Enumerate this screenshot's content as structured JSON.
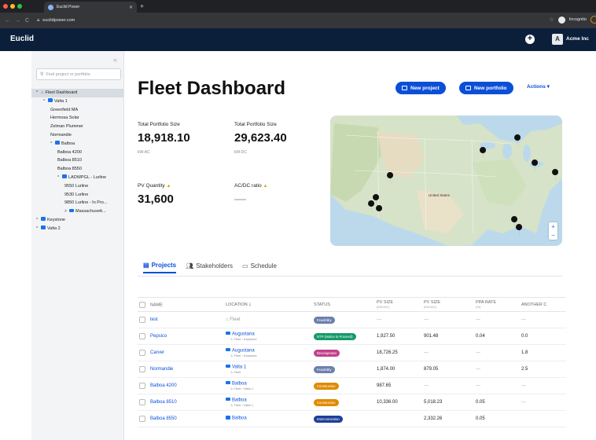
{
  "browser": {
    "tab_title": "Euclid Power",
    "url": "euclidpower.com",
    "incognito_label": "Incognito"
  },
  "header": {
    "brand": "Euclid",
    "avatar_letter": "A",
    "org_name": "Acme Inc"
  },
  "sidebar": {
    "search_placeholder": "Find project or portfolio",
    "tree": [
      {
        "label": "Fleet Dashboard",
        "indent": 0,
        "caret": "^",
        "icon": "home",
        "active": true
      },
      {
        "label": "Valta 1",
        "indent": 1,
        "caret": "^",
        "icon": "folder"
      },
      {
        "label": "Greenfield MA",
        "indent": 2
      },
      {
        "label": "Hermosa Solar",
        "indent": 2
      },
      {
        "label": "Zelman Plummer",
        "indent": 2
      },
      {
        "label": "Normandie",
        "indent": 2
      },
      {
        "label": "Balboa",
        "indent": 2,
        "caret": "^",
        "icon": "folder"
      },
      {
        "label": "Balboa 4200",
        "indent": 3
      },
      {
        "label": "Balboa 8510",
        "indent": 3
      },
      {
        "label": "Balboa 8550",
        "indent": 3
      },
      {
        "label": "LADWPGL - Lurline",
        "indent": 3,
        "caret": "^",
        "icon": "folder"
      },
      {
        "label": "9550 Lurline",
        "indent": 4
      },
      {
        "label": "9530 Lurline",
        "indent": 4
      },
      {
        "label": "9850 Lurline - In Pro...",
        "indent": 4
      },
      {
        "label": "Massachusett...",
        "indent": 4,
        "caret": ">",
        "icon": "folder"
      },
      {
        "label": "Keystone",
        "indent": 0,
        "caret": "^",
        "icon": "folder"
      },
      {
        "label": "Valta 2",
        "indent": 0,
        "caret": "^",
        "icon": "folder"
      }
    ]
  },
  "main": {
    "title": "Fleet Dashboard",
    "new_project_label": "New project",
    "new_portfolio_label": "New portfolio",
    "actions_label": "Actions",
    "stats": {
      "total_ac_label": "Total Portfolio Size",
      "total_ac_value": "18,918.10",
      "total_ac_unit": "kW-AC",
      "total_dc_label": "Total Portfolio Size",
      "total_dc_value": "29,623.40",
      "total_dc_unit": "kW-DC",
      "pv_qty_label": "PV Quantity",
      "pv_qty_value": "31,600",
      "acdc_label": "AC/DC ratio",
      "acdc_value": "—"
    },
    "map": {
      "label_us": "United States"
    },
    "tabs": [
      "Projects",
      "Stakeholders",
      "Schedule"
    ],
    "table": {
      "headers": {
        "name": "NAME",
        "location": "LOCATION",
        "status": "STATUS",
        "pv_dc": "PV SIZE",
        "pv_dc_unit": "(kW-DC)",
        "pv_ac": "PV SIZE",
        "pv_ac_unit": "(kW-AC)",
        "ppa": "PPA RATE",
        "ppa_unit": "(%)",
        "another": "ANOTHER C"
      },
      "rows": [
        {
          "name": "test",
          "loc": "Fleet",
          "loc_sub": "",
          "status": "Feasibility",
          "status_color": "#6b7fae",
          "dc": "—",
          "ac": "—",
          "ppa": "—",
          "another": "—"
        },
        {
          "name": "Pepsico",
          "loc": "Augustana",
          "loc_sub": "Fleet › Keystone",
          "status": "NTP (Notice to Proceed)",
          "status_color": "#159a6a",
          "dc": "1,927.50",
          "ac": "901.48",
          "ppa": "0.04",
          "another": "0.0"
        },
        {
          "name": "Carver",
          "loc": "Augustana",
          "loc_sub": "Fleet › Keystone",
          "status": "Development",
          "status_color": "#c2418a",
          "dc": "18,726.25",
          "ac": "—",
          "ppa": "—",
          "another": "1.8"
        },
        {
          "name": "Normandie",
          "loc": "Valta 1",
          "loc_sub": "Fleet",
          "status": "Feasibility",
          "status_color": "#6b7fae",
          "dc": "1,874.00",
          "ac": "879.05",
          "ppa": "—",
          "another": "2.5"
        },
        {
          "name": "Balboa 4200",
          "loc": "Balboa",
          "loc_sub": "Fleet › Valta 1",
          "status": "Construction",
          "status_color": "#e08a00",
          "dc": "987.65",
          "ac": "—",
          "ppa": "—",
          "another": "—"
        },
        {
          "name": "Balboa 8510",
          "loc": "Balboa",
          "loc_sub": "Fleet › Valta 1",
          "status": "Construction",
          "status_color": "#e08a00",
          "dc": "10,336.00",
          "ac": "5,018.23",
          "ppa": "0.05",
          "another": "—"
        },
        {
          "name": "Balboa 8550",
          "loc": "Balboa",
          "loc_sub": "",
          "status": "Interconnection",
          "status_color": "#1e3f9a",
          "dc": "",
          "ac": "2,332.26",
          "ppa": "0.05",
          "another": ""
        }
      ]
    }
  }
}
